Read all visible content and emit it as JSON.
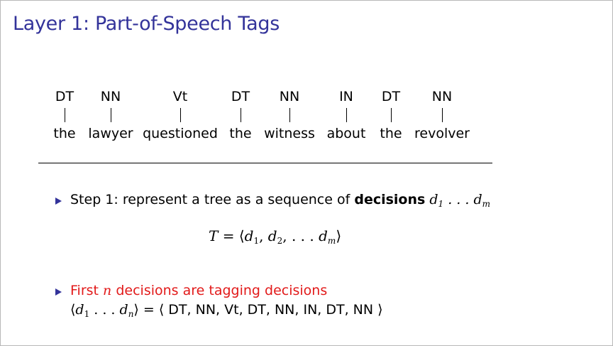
{
  "title": "Layer 1: Part-of-Speech Tags",
  "tagged_sentence": [
    {
      "tag": "DT",
      "word": "the"
    },
    {
      "tag": "NN",
      "word": "lawyer"
    },
    {
      "tag": "Vt",
      "word": "questioned"
    },
    {
      "tag": "DT",
      "word": "the"
    },
    {
      "tag": "NN",
      "word": "witness"
    },
    {
      "tag": "IN",
      "word": "about"
    },
    {
      "tag": "DT",
      "word": "the"
    },
    {
      "tag": "NN",
      "word": "revolver"
    }
  ],
  "bullet1": {
    "text": "Step 1: represent a tree as a sequence of",
    "bold": "decisions"
  },
  "bullet2": {
    "text_a": "First",
    "var": "n",
    "text_b": "decisions are tagging decisions",
    "tag_list": "DT, NN, Vt, DT, NN, IN, DT, NN"
  },
  "colors": {
    "title": "#33339a",
    "red": "#e21a1a",
    "bullet": "#33339a"
  }
}
